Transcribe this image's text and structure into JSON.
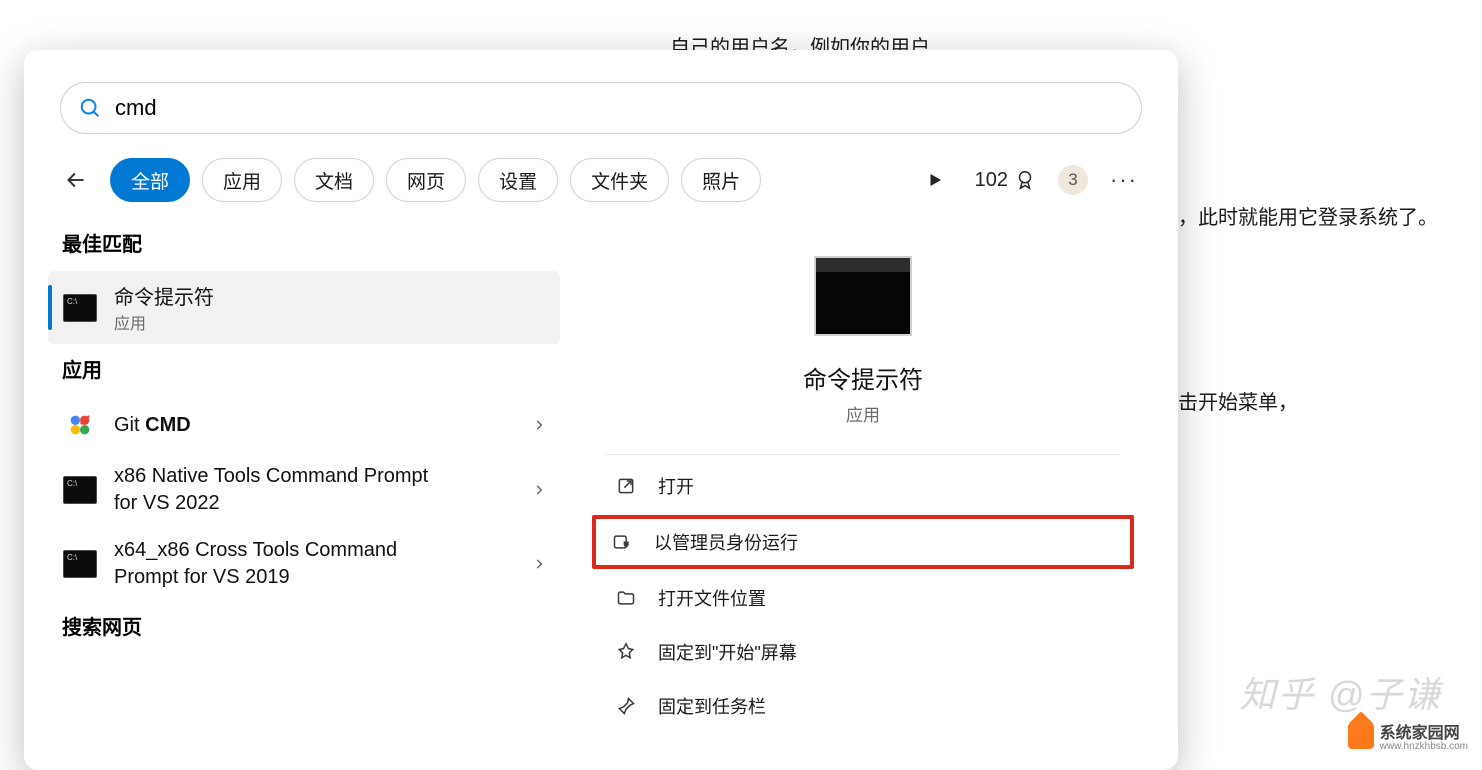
{
  "background_article": {
    "line1_partial": "自己的用户名，例如你的用户",
    "line2_partial": "，此时就能用它登录系统了。",
    "line3_partial": "击开始菜单，"
  },
  "watermarks": {
    "zhihu": "知乎 @子谦",
    "site_name": "系统家园网",
    "site_url": "www.hnzkhbsb.com"
  },
  "search": {
    "query": "cmd"
  },
  "filters": {
    "tabs": [
      "全部",
      "应用",
      "文档",
      "网页",
      "设置",
      "文件夹",
      "照片"
    ],
    "active_index": 0,
    "points_value": "102",
    "notif_badge": "3"
  },
  "left_pane": {
    "best_match_header": "最佳匹配",
    "best_match": {
      "title": "命令提示符",
      "subtitle": "应用"
    },
    "apps_header": "应用",
    "apps": [
      {
        "title_prefix": "Git ",
        "title_bold": "CMD"
      },
      {
        "title_plain": "x86 Native Tools Command Prompt for VS 2022"
      },
      {
        "title_plain": "x64_x86 Cross Tools Command Prompt for VS 2019"
      }
    ],
    "web_header": "搜索网页"
  },
  "right_pane": {
    "app_title": "命令提示符",
    "app_sub": "应用",
    "actions": {
      "open": "打开",
      "run_admin": "以管理员身份运行",
      "open_location": "打开文件位置",
      "pin_start": "固定到\"开始\"屏幕",
      "pin_taskbar": "固定到任务栏"
    }
  }
}
